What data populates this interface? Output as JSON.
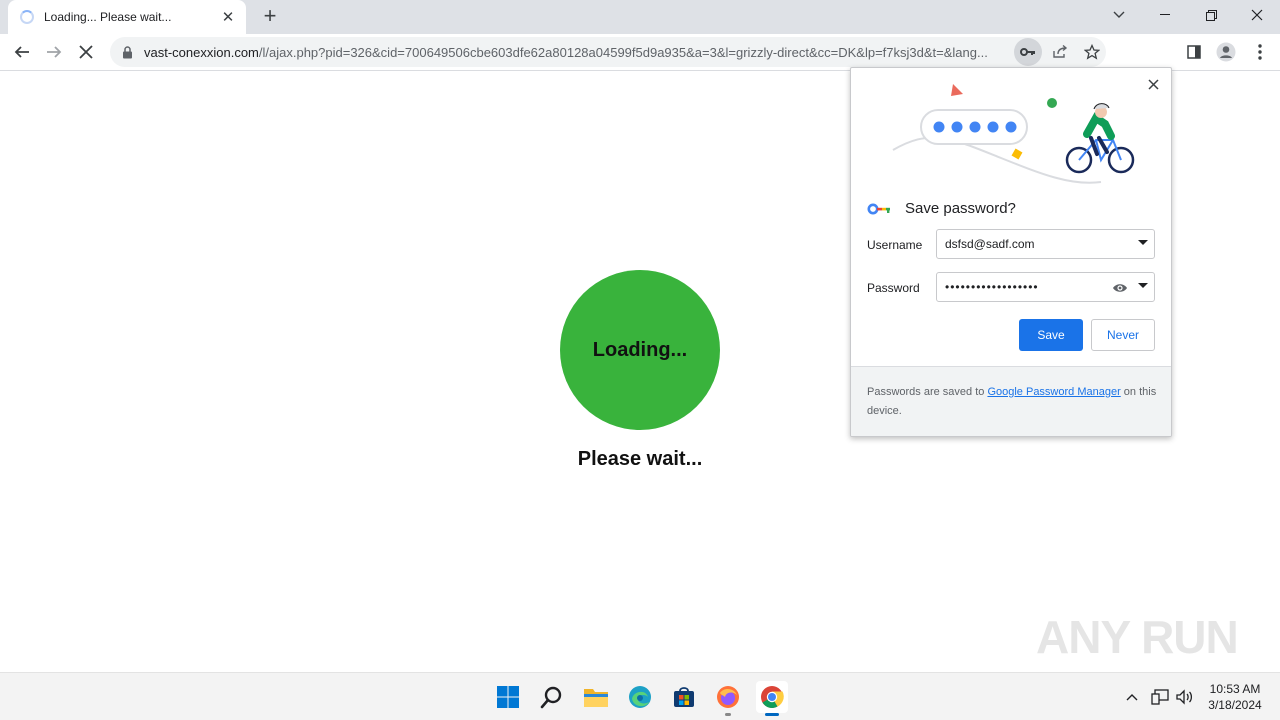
{
  "tab": {
    "title": "Loading... Please wait...",
    "close": "✕",
    "new_tab": "+"
  },
  "window": {
    "minimize": "—",
    "maximize": "❐",
    "close": "✕",
    "tab_search": "⌄"
  },
  "toolbar": {
    "host": "vast-conexxion.com",
    "path": "/l/ajax.php?pid=326&cid=700649506cbe603dfe62a80128a04599f5d9a935&a=3&l=grizzly-direct&cc=DK&lp=f7ksj3d&t=&lang..."
  },
  "page": {
    "loading": "Loading...",
    "wait": "Please wait...",
    "loader_color": "#39b33c"
  },
  "password_bubble": {
    "title": "Save password?",
    "username_label": "Username",
    "username_value": "dsfsd@sadf.com",
    "password_label": "Password",
    "password_value": "••••••••••••••••••",
    "save": "Save",
    "never": "Never",
    "footer_prefix": "Passwords are saved to ",
    "footer_link": "Google Password Manager",
    "footer_suffix": " on this device."
  },
  "watermark": "ANY RUN",
  "taskbar": {
    "apps": [
      "start",
      "search",
      "file-explorer",
      "edge",
      "store",
      "firefox",
      "chrome"
    ],
    "time": "10:53 AM",
    "date": "3/18/2024"
  },
  "colors": {
    "accent": "#1a73e8",
    "tabstrip": "#dee1e6",
    "loader": "#39b33c"
  }
}
